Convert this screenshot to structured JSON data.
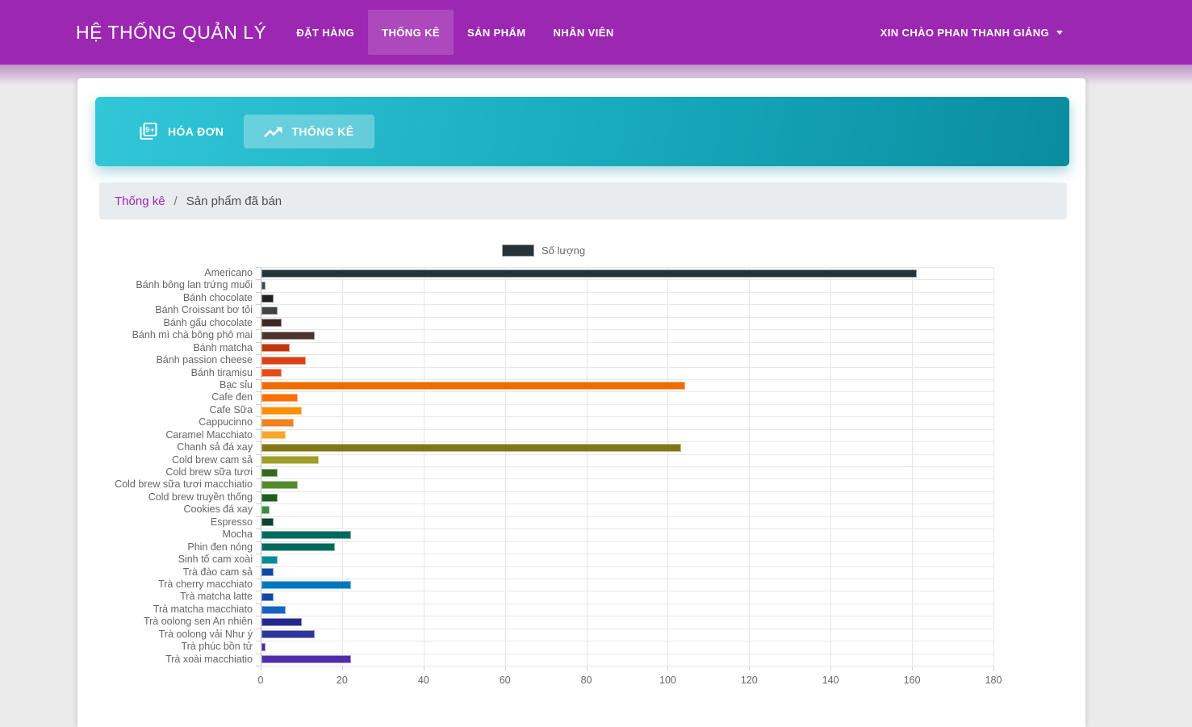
{
  "header": {
    "title": "HỆ THỐNG QUẢN LÝ",
    "nav": [
      {
        "label": "ĐẶT HÀNG",
        "active": false
      },
      {
        "label": "THỐNG KÊ",
        "active": true
      },
      {
        "label": "SẢN PHẨM",
        "active": false
      },
      {
        "label": "NHÂN VIÊN",
        "active": false
      }
    ],
    "user_greeting": "XIN CHÀO PHAN THANH GIẢNG"
  },
  "toolbar": {
    "tabs": [
      {
        "label": "HÓA ĐƠN",
        "icon": "invoice-icon",
        "active": false
      },
      {
        "label": "THỐNG KÊ",
        "icon": "trending-up-icon",
        "active": true
      }
    ]
  },
  "breadcrumb": {
    "items": [
      "Thống kê",
      "Sản phẩm đã bán"
    ],
    "separator": "/"
  },
  "colors": {
    "header_bg": "#9c27b0",
    "panel_gradient_start": "#31c6d8",
    "panel_gradient_end": "#0a8c9f",
    "breadcrumb_bg": "#e9ecef",
    "link": "#9c27b0",
    "legend_swatch": "#263238"
  },
  "chart_data": {
    "type": "bar",
    "orientation": "horizontal",
    "legend": [
      "Số lượng"
    ],
    "legend_position": "top",
    "legend_color": "#263238",
    "grid": true,
    "xlim": [
      0,
      180
    ],
    "x_ticks": [
      0,
      20,
      40,
      60,
      80,
      100,
      120,
      140,
      160,
      180
    ],
    "categories": [
      "Americano",
      "Bánh bông lan trứng muối",
      "Bánh chocolate",
      "Bánh Croissant bơ tỏi",
      "Bánh gấu chocolate",
      "Bánh mì chà bông phô mai",
      "Bánh matcha",
      "Bánh passion cheese",
      "Bánh tiramisu",
      "Bạc sỉu",
      "Cafe đen",
      "Cafe Sữa",
      "Cappucinno",
      "Caramel Macchiato",
      "Chanh sả đá xay",
      "Cold brew cam sả",
      "Cold brew sữa tươi",
      "Cold brew sữa tươi macchiatio",
      "Cold brew truyền thống",
      "Cookies đá xay",
      "Espresso",
      "Mocha",
      "Phin đen nóng",
      "Sinh tố cam xoài",
      "Trà đào cam sả",
      "Trà cherry macchiato",
      "Trà matcha latte",
      "Trà matcha macchiato",
      "Trà oolong sen An nhiên",
      "Trà oolong vải Như ý",
      "Trà phúc bồn tử",
      "Trà xoài macchiatio"
    ],
    "values": [
      161,
      1,
      3,
      4,
      5,
      13,
      7,
      11,
      5,
      104,
      9,
      10,
      8,
      6,
      103,
      14,
      4,
      9,
      4,
      2,
      3,
      22,
      18,
      4,
      3,
      22,
      3,
      6,
      10,
      13,
      1,
      22
    ],
    "bar_colors": [
      "#263238",
      "#37474f",
      "#212121",
      "#424242",
      "#3e2723",
      "#4e342e",
      "#bf360c",
      "#d84315",
      "#e64a19",
      "#ef6c00",
      "#ff6f00",
      "#ff8f00",
      "#f1801f",
      "#f9a62c",
      "#827717",
      "#9e9d24",
      "#33691e",
      "#558b2f",
      "#1b5e20",
      "#388e3c",
      "#0a4331",
      "#00695c",
      "#00695c",
      "#038b98",
      "#0d47a1",
      "#0277bd",
      "#1444a5",
      "#1565c0",
      "#23278c",
      "#2e359c",
      "#4527a0",
      "#4f2da8"
    ]
  }
}
